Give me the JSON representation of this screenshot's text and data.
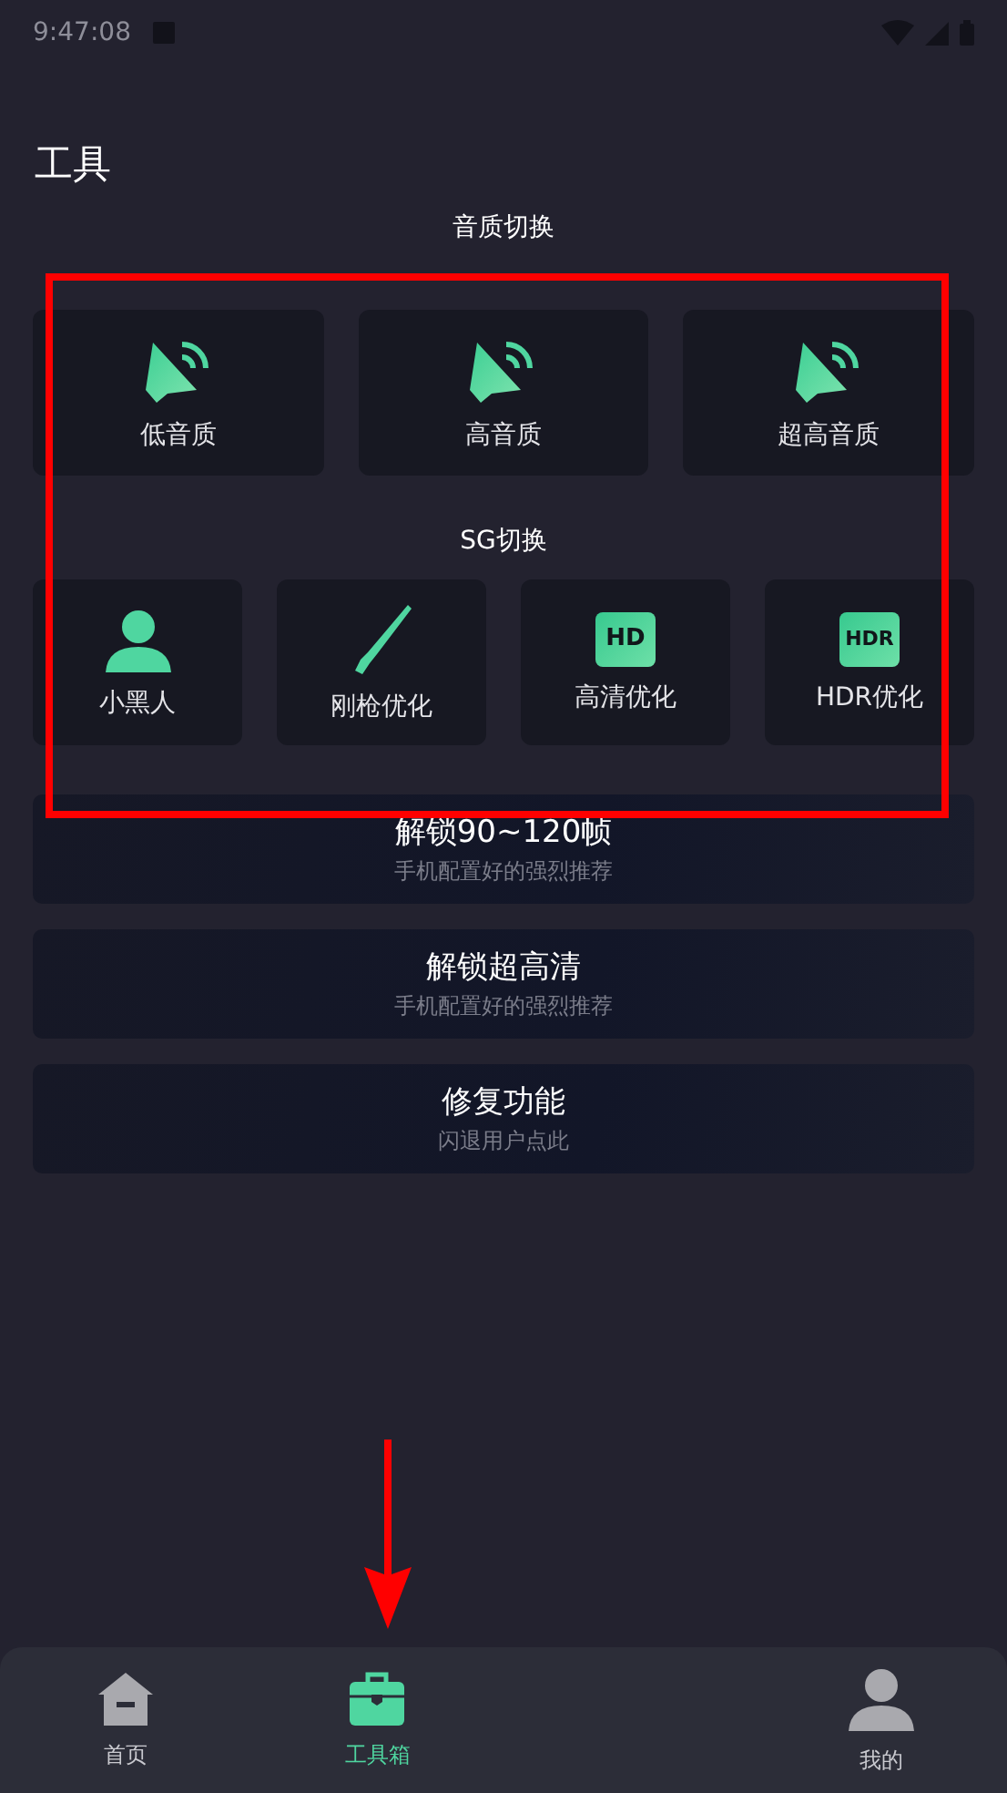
{
  "status_bar": {
    "time": "9:47:08"
  },
  "title": "工具",
  "sound_section": {
    "heading": "音质切换",
    "items": [
      {
        "label": "低音质",
        "kind": "speaker"
      },
      {
        "label": "高音质",
        "kind": "speaker"
      },
      {
        "label": "超高音质",
        "kind": "speaker"
      }
    ]
  },
  "sg_section": {
    "heading": "SG切换",
    "items": [
      {
        "label": "小黑人",
        "kind": "person"
      },
      {
        "label": "刚枪优化",
        "kind": "rifle"
      },
      {
        "label": "高清优化",
        "kind": "hd",
        "badge": "HD"
      },
      {
        "label": "HDR优化",
        "kind": "hd",
        "badge": "HDR"
      }
    ]
  },
  "options": [
    {
      "title": "解锁90~120帧",
      "subtitle": "手机配置好的强烈推荐"
    },
    {
      "title": "解锁超高清",
      "subtitle": "手机配置好的强烈推荐"
    },
    {
      "title": "修复功能",
      "subtitle": "闪退用户点此"
    }
  ],
  "bottom_nav": [
    {
      "label": "首页",
      "selected": false
    },
    {
      "label": "工具箱",
      "selected": true
    },
    {
      "label": "我的",
      "selected": false
    }
  ]
}
